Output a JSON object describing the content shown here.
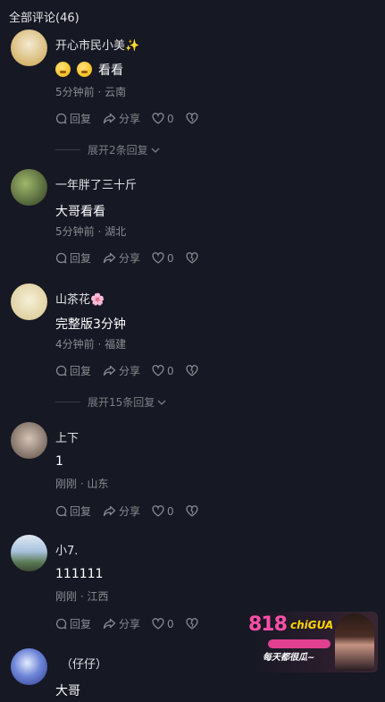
{
  "header": {
    "title": "全部评论(46)"
  },
  "actions": {
    "reply": "回复",
    "share": "分享"
  },
  "comments": [
    {
      "username": "开心市民小美✨",
      "text": "看看",
      "has_emojis": true,
      "meta": "5分钟前 · 云南",
      "likes": "0",
      "expand": "展开2条回复",
      "avatar_colors": [
        "#e8d9b0",
        "#caa24c"
      ]
    },
    {
      "username": "一年胖了三十斤",
      "text": "大哥看看",
      "meta": "5分钟前 · 湖北",
      "likes": "0",
      "avatar_colors": [
        "#6b8a4a",
        "#2e3b22"
      ]
    },
    {
      "username": "山茶花🌸",
      "text": "完整版3分钟",
      "meta": "4分钟前 · 福建",
      "likes": "0",
      "expand": "展开15条回复",
      "avatar_colors": [
        "#f1e8c8",
        "#d7c48c"
      ]
    },
    {
      "username": "上下",
      "text": "1",
      "meta": "刚刚 · 山东",
      "likes": "0",
      "avatar_colors": [
        "#b9a596",
        "#5a4a42"
      ]
    },
    {
      "username": "小7.",
      "text": "111111",
      "meta": "刚刚 · 江西",
      "likes": "0",
      "avatar_colors": [
        "#cfe0f2",
        "#5b7a55"
      ]
    },
    {
      "username": "（仔仔）",
      "text": "大哥",
      "avatar_colors": [
        "#c9d6ff",
        "#2b3a8c"
      ]
    }
  ],
  "watermark": {
    "logo": "818",
    "logo_sub": "chiGUA",
    "slogan": "每天都很瓜~"
  },
  "colors": {
    "background": "#161823",
    "secondary_text": "#8a8b91"
  }
}
